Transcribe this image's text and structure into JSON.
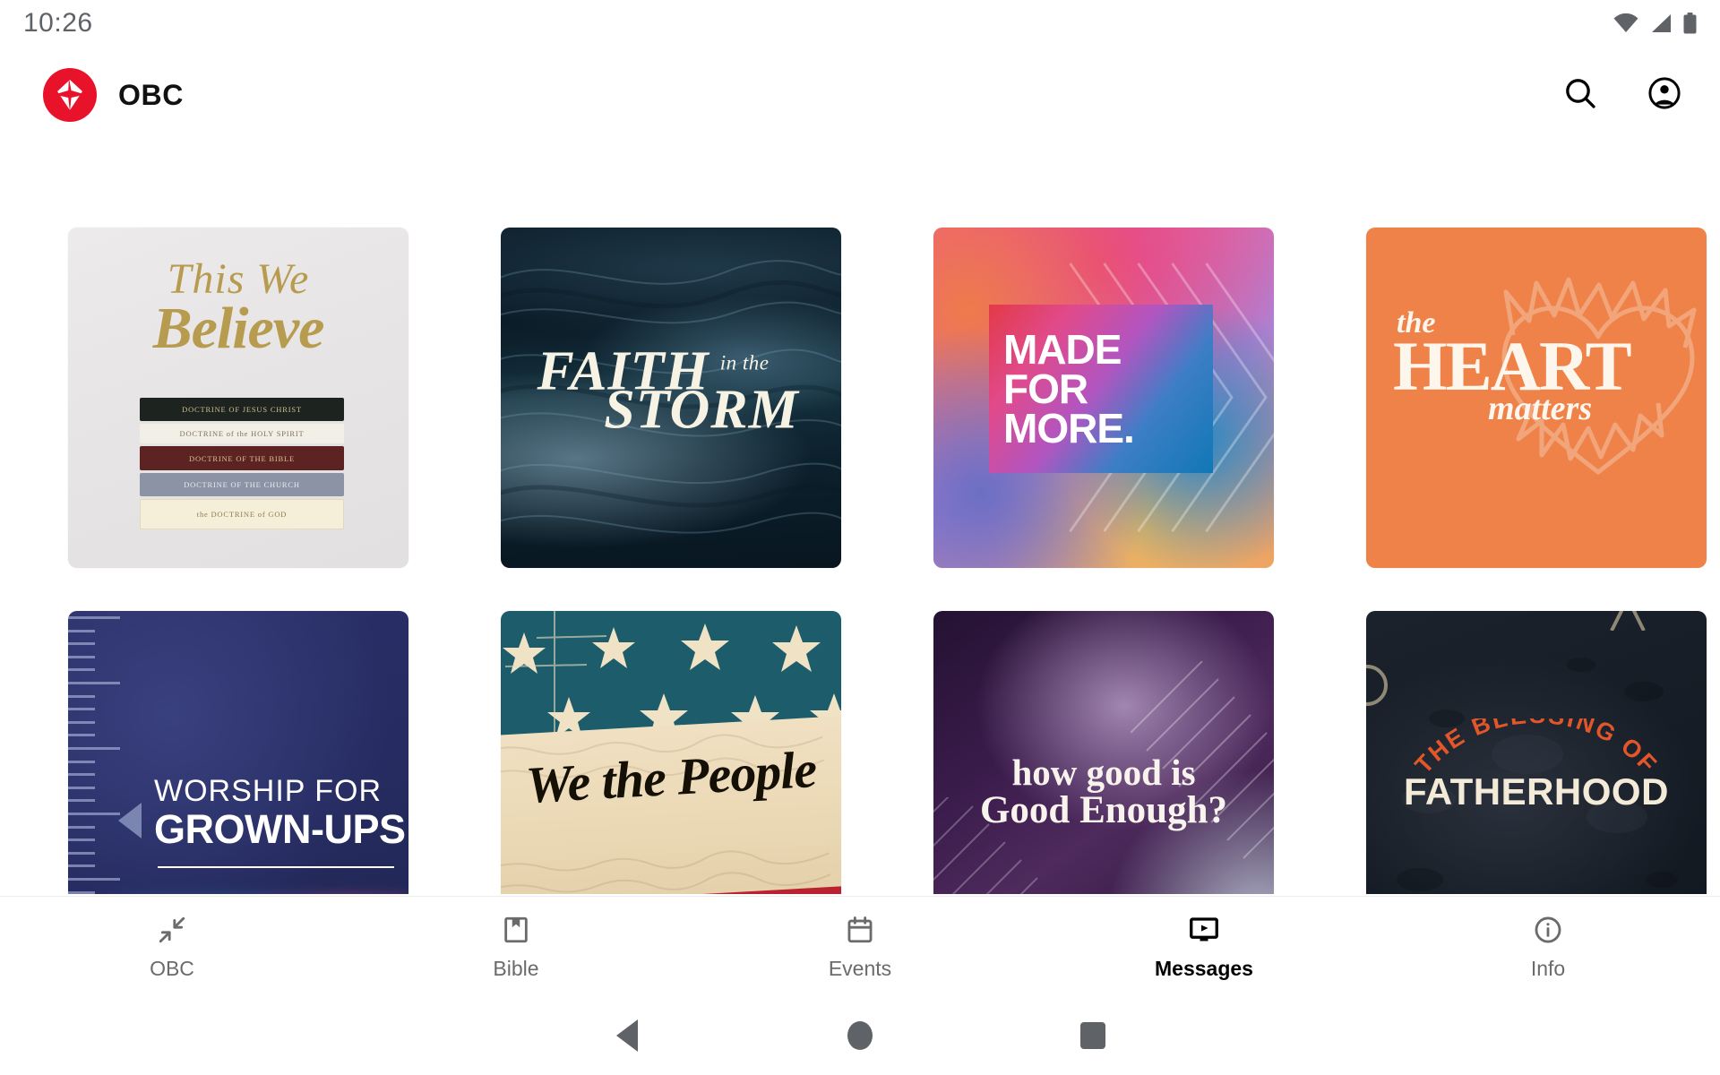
{
  "status_bar": {
    "time": "10:26",
    "icons": [
      "wifi-icon",
      "cell-signal-icon",
      "battery-icon"
    ]
  },
  "app_bar": {
    "logo_icon": "obc-cross-logo-icon",
    "title": "OBC",
    "search_icon": "search-icon",
    "account_icon": "account-circle-icon",
    "brand_color": "#e8122a"
  },
  "messages_grid": {
    "items": [
      {
        "id": "this-we-believe",
        "title": "This We Believe",
        "title_line1": "This We",
        "title_line2": "Believe",
        "books": [
          "DOCTRINE OF JESUS CHRIST",
          "DOCTRINE of the HOLY SPIRIT",
          "DOCTRINE OF THE BIBLE",
          "DOCTRINE OF THE CHURCH",
          "the DOCTRINE of GOD"
        ]
      },
      {
        "id": "faith-in-the-storm",
        "title": "FAITH in the STORM",
        "line1": "FAITH",
        "line_small": "in the",
        "line2": "STORM"
      },
      {
        "id": "made-for-more",
        "title": "MADE FOR MORE.",
        "line1": "MADE",
        "line2": "FOR",
        "line3": "MORE."
      },
      {
        "id": "the-heart-matters",
        "title": "the HEART matters",
        "line_the": "the",
        "line_main": "HEART",
        "line_sub": "matters"
      },
      {
        "id": "worship-for-grown-ups",
        "title": "WORSHIP FOR GROWN-UPS",
        "line1": "WORSHIP FOR",
        "line2": "GROWN-UPS"
      },
      {
        "id": "we-the-people",
        "title": "We the People",
        "line1": "We the People"
      },
      {
        "id": "how-good-is-good-enough",
        "title": "how good is Good Enough?",
        "line1": "how good is",
        "line2": "Good Enough?"
      },
      {
        "id": "the-blessing-of-fatherhood",
        "title": "THE BLESSING OF FATHERHOOD",
        "line_arc": "THE BLESSING OF",
        "line_main": "FATHERHOOD"
      }
    ]
  },
  "tab_bar": {
    "active_index": 3,
    "tabs": [
      {
        "label": "OBC",
        "icon": "collapse-arrows-icon"
      },
      {
        "label": "Bible",
        "icon": "book-bookmark-icon"
      },
      {
        "label": "Events",
        "icon": "calendar-icon"
      },
      {
        "label": "Messages",
        "icon": "video-monitor-play-icon"
      },
      {
        "label": "Info",
        "icon": "info-circle-icon"
      }
    ]
  },
  "system_nav": {
    "back_icon": "android-back-icon",
    "home_icon": "android-home-icon",
    "recents_icon": "android-recents-icon"
  }
}
